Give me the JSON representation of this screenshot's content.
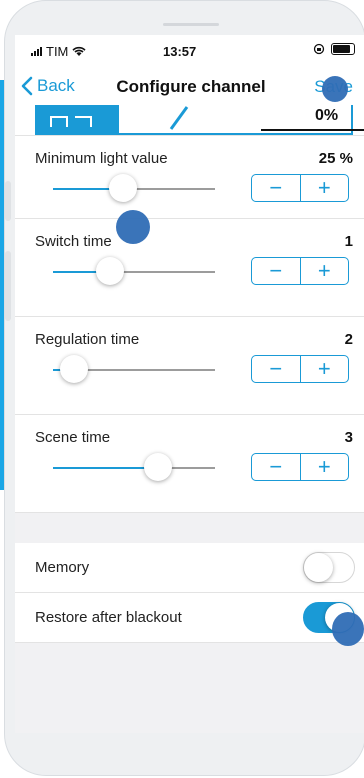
{
  "status_bar": {
    "carrier": "TIM",
    "time": "13:57"
  },
  "nav": {
    "back_label": "Back",
    "title": "Configure channel",
    "save_label": "Save"
  },
  "preview": {
    "percent": "0%"
  },
  "settings": [
    {
      "label": "Minimum light value",
      "value": "25 %",
      "slider_fraction": 0.43
    },
    {
      "label": "Switch time",
      "value": "1",
      "slider_fraction": 0.35
    },
    {
      "label": "Regulation time",
      "value": "2",
      "slider_fraction": 0.13
    },
    {
      "label": "Scene time",
      "value": "3",
      "slider_fraction": 0.65
    }
  ],
  "stepper": {
    "minus": "−",
    "plus": "+"
  },
  "toggles": [
    {
      "label": "Memory",
      "on": false
    },
    {
      "label": "Restore after blackout",
      "on": true
    }
  ],
  "colors": {
    "accent": "#1a9ad6",
    "strip": "#1aa6e6",
    "touch_marker": "#2f6db5"
  }
}
